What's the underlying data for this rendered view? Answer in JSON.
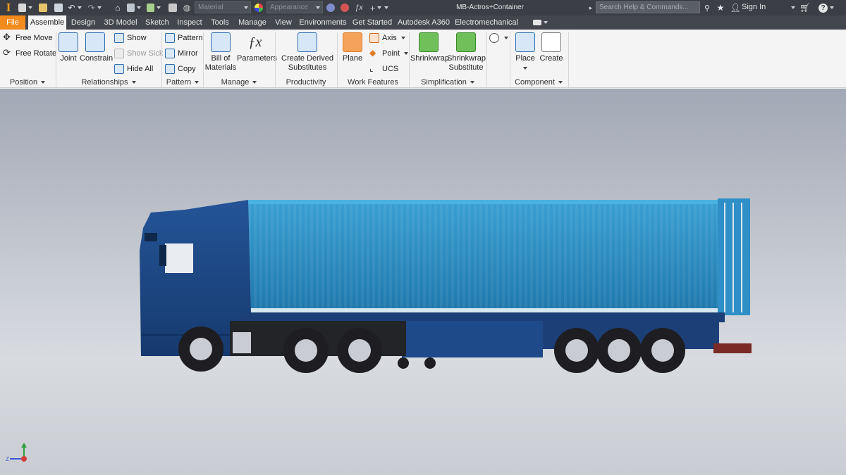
{
  "window": {
    "title": "MB-Actros+Container",
    "search_placeholder": "Search Help & Commands...",
    "sign_in": "Sign In",
    "material_placeholder": "Material",
    "appearance_placeholder": "Appearance"
  },
  "tabs": [
    {
      "label": "File"
    },
    {
      "label": "Assemble"
    },
    {
      "label": "Design"
    },
    {
      "label": "3D Model"
    },
    {
      "label": "Sketch"
    },
    {
      "label": "Inspect"
    },
    {
      "label": "Tools"
    },
    {
      "label": "Manage"
    },
    {
      "label": "View"
    },
    {
      "label": "Environments"
    },
    {
      "label": "Get Started"
    },
    {
      "label": "Autodesk A360"
    },
    {
      "label": "Electromechanical"
    }
  ],
  "ribbon": {
    "position": {
      "label": "Position",
      "free_move": "Free Move",
      "free_rotate": "Free Rotate"
    },
    "relationships": {
      "label": "Relationships",
      "joint": "Joint",
      "constrain": "Constrain",
      "show": "Show",
      "show_sick": "Show Sick",
      "hide_all": "Hide All"
    },
    "pattern": {
      "label": "Pattern",
      "pattern": "Pattern",
      "mirror": "Mirror",
      "copy": "Copy"
    },
    "manage": {
      "label": "Manage",
      "bom_line1": "Bill of",
      "bom_line2": "Materials",
      "parameters": "Parameters"
    },
    "productivity": {
      "label": "Productivity",
      "derived_line1": "Create Derived",
      "derived_line2": "Substitutes"
    },
    "work_features": {
      "label": "Work Features",
      "plane": "Plane",
      "axis": "Axis",
      "point": "Point",
      "ucs": "UCS"
    },
    "simplification": {
      "label": "Simplification",
      "shrinkwrap": "Shrinkwrap",
      "shrinkwrap_sub_line1": "Shrinkwrap",
      "shrinkwrap_sub_line2": "Substitute"
    },
    "component": {
      "label": "Component",
      "place": "Place",
      "create": "Create"
    }
  },
  "viewport": {
    "triad_labels": {
      "x": "X",
      "y": "Y",
      "z": "Z"
    },
    "colors": {
      "cab": "#1e4a8a",
      "container": "#2d8bbd",
      "chassis": "#1d3f78",
      "tire": "#1e1e22",
      "rim": "#c9cdd3"
    }
  }
}
